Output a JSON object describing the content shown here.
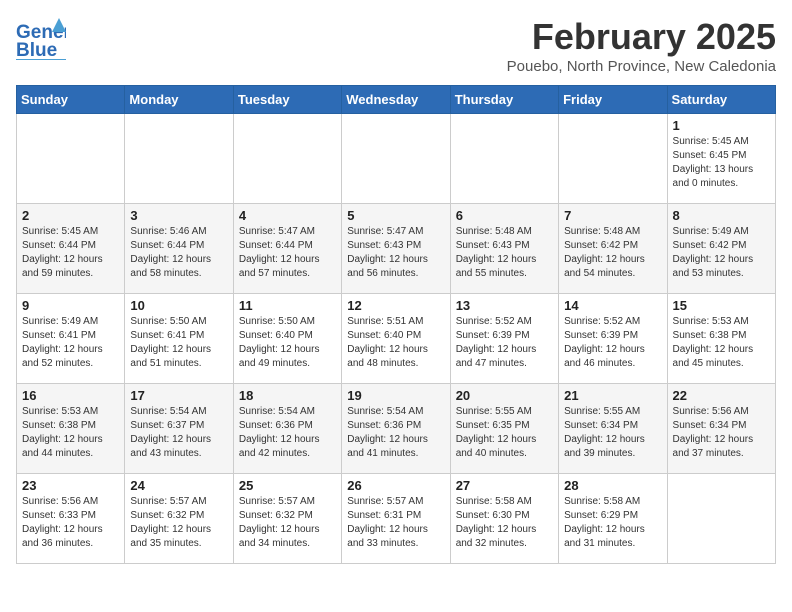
{
  "header": {
    "logo_line1": "General",
    "logo_line2": "Blue",
    "month": "February 2025",
    "location": "Pouebo, North Province, New Caledonia"
  },
  "weekdays": [
    "Sunday",
    "Monday",
    "Tuesday",
    "Wednesday",
    "Thursday",
    "Friday",
    "Saturday"
  ],
  "weeks": [
    [
      {
        "day": "",
        "info": ""
      },
      {
        "day": "",
        "info": ""
      },
      {
        "day": "",
        "info": ""
      },
      {
        "day": "",
        "info": ""
      },
      {
        "day": "",
        "info": ""
      },
      {
        "day": "",
        "info": ""
      },
      {
        "day": "1",
        "info": "Sunrise: 5:45 AM\nSunset: 6:45 PM\nDaylight: 13 hours\nand 0 minutes."
      }
    ],
    [
      {
        "day": "2",
        "info": "Sunrise: 5:45 AM\nSunset: 6:44 PM\nDaylight: 12 hours\nand 59 minutes."
      },
      {
        "day": "3",
        "info": "Sunrise: 5:46 AM\nSunset: 6:44 PM\nDaylight: 12 hours\nand 58 minutes."
      },
      {
        "day": "4",
        "info": "Sunrise: 5:47 AM\nSunset: 6:44 PM\nDaylight: 12 hours\nand 57 minutes."
      },
      {
        "day": "5",
        "info": "Sunrise: 5:47 AM\nSunset: 6:43 PM\nDaylight: 12 hours\nand 56 minutes."
      },
      {
        "day": "6",
        "info": "Sunrise: 5:48 AM\nSunset: 6:43 PM\nDaylight: 12 hours\nand 55 minutes."
      },
      {
        "day": "7",
        "info": "Sunrise: 5:48 AM\nSunset: 6:42 PM\nDaylight: 12 hours\nand 54 minutes."
      },
      {
        "day": "8",
        "info": "Sunrise: 5:49 AM\nSunset: 6:42 PM\nDaylight: 12 hours\nand 53 minutes."
      }
    ],
    [
      {
        "day": "9",
        "info": "Sunrise: 5:49 AM\nSunset: 6:41 PM\nDaylight: 12 hours\nand 52 minutes."
      },
      {
        "day": "10",
        "info": "Sunrise: 5:50 AM\nSunset: 6:41 PM\nDaylight: 12 hours\nand 51 minutes."
      },
      {
        "day": "11",
        "info": "Sunrise: 5:50 AM\nSunset: 6:40 PM\nDaylight: 12 hours\nand 49 minutes."
      },
      {
        "day": "12",
        "info": "Sunrise: 5:51 AM\nSunset: 6:40 PM\nDaylight: 12 hours\nand 48 minutes."
      },
      {
        "day": "13",
        "info": "Sunrise: 5:52 AM\nSunset: 6:39 PM\nDaylight: 12 hours\nand 47 minutes."
      },
      {
        "day": "14",
        "info": "Sunrise: 5:52 AM\nSunset: 6:39 PM\nDaylight: 12 hours\nand 46 minutes."
      },
      {
        "day": "15",
        "info": "Sunrise: 5:53 AM\nSunset: 6:38 PM\nDaylight: 12 hours\nand 45 minutes."
      }
    ],
    [
      {
        "day": "16",
        "info": "Sunrise: 5:53 AM\nSunset: 6:38 PM\nDaylight: 12 hours\nand 44 minutes."
      },
      {
        "day": "17",
        "info": "Sunrise: 5:54 AM\nSunset: 6:37 PM\nDaylight: 12 hours\nand 43 minutes."
      },
      {
        "day": "18",
        "info": "Sunrise: 5:54 AM\nSunset: 6:36 PM\nDaylight: 12 hours\nand 42 minutes."
      },
      {
        "day": "19",
        "info": "Sunrise: 5:54 AM\nSunset: 6:36 PM\nDaylight: 12 hours\nand 41 minutes."
      },
      {
        "day": "20",
        "info": "Sunrise: 5:55 AM\nSunset: 6:35 PM\nDaylight: 12 hours\nand 40 minutes."
      },
      {
        "day": "21",
        "info": "Sunrise: 5:55 AM\nSunset: 6:34 PM\nDaylight: 12 hours\nand 39 minutes."
      },
      {
        "day": "22",
        "info": "Sunrise: 5:56 AM\nSunset: 6:34 PM\nDaylight: 12 hours\nand 37 minutes."
      }
    ],
    [
      {
        "day": "23",
        "info": "Sunrise: 5:56 AM\nSunset: 6:33 PM\nDaylight: 12 hours\nand 36 minutes."
      },
      {
        "day": "24",
        "info": "Sunrise: 5:57 AM\nSunset: 6:32 PM\nDaylight: 12 hours\nand 35 minutes."
      },
      {
        "day": "25",
        "info": "Sunrise: 5:57 AM\nSunset: 6:32 PM\nDaylight: 12 hours\nand 34 minutes."
      },
      {
        "day": "26",
        "info": "Sunrise: 5:57 AM\nSunset: 6:31 PM\nDaylight: 12 hours\nand 33 minutes."
      },
      {
        "day": "27",
        "info": "Sunrise: 5:58 AM\nSunset: 6:30 PM\nDaylight: 12 hours\nand 32 minutes."
      },
      {
        "day": "28",
        "info": "Sunrise: 5:58 AM\nSunset: 6:29 PM\nDaylight: 12 hours\nand 31 minutes."
      },
      {
        "day": "",
        "info": ""
      }
    ]
  ]
}
